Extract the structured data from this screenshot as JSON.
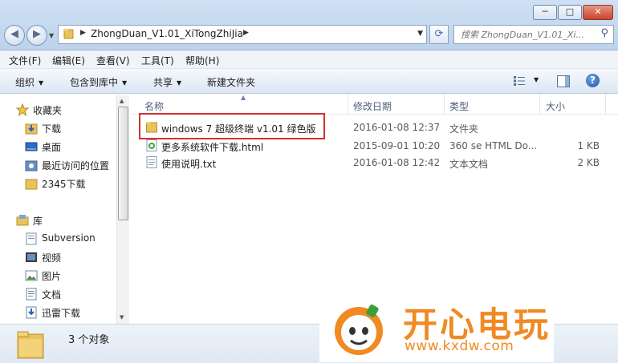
{
  "window": {
    "controls": {
      "minimize": "─",
      "maximize": "□",
      "close": "✕"
    }
  },
  "nav_buttons": {
    "back": "◀",
    "forward": "▶"
  },
  "address": {
    "path": "ZhongDuan_V1.01_XiTongZhiJia"
  },
  "search": {
    "placeholder": "搜索 ZhongDuan_V1.01_Xi..."
  },
  "menu": {
    "file": "文件(F)",
    "edit": "编辑(E)",
    "view": "查看(V)",
    "tools": "工具(T)",
    "help": "帮助(H)"
  },
  "toolbar": {
    "organize": "组织",
    "include_library": "包含到库中",
    "share": "共享",
    "new_folder": "新建文件夹",
    "help": "?"
  },
  "sidebar": {
    "favorites": "收藏夹",
    "downloads": "下载",
    "desktop": "桌面",
    "recent": "最近访问的位置",
    "dl2345": "2345下载",
    "libraries": "库",
    "subversion": "Subversion",
    "videos": "视频",
    "pictures": "图片",
    "documents": "文档",
    "thunder": "迅雷下载"
  },
  "columns": {
    "name": "名称",
    "modified": "修改日期",
    "type": "类型",
    "size": "大小"
  },
  "files": [
    {
      "name": "windows 7 超级终端 v1.01 绿色版",
      "modified": "2016-01-08 12:37",
      "type": "文件夹",
      "size": "",
      "icon": "folder-icon"
    },
    {
      "name": "更多系统软件下载.html",
      "modified": "2015-09-01 10:20",
      "type": "360 se HTML Do...",
      "size": "1 KB",
      "icon": "html-file-icon"
    },
    {
      "name": "使用说明.txt",
      "modified": "2016-01-08 12:42",
      "type": "文本文档",
      "size": "2 KB",
      "icon": "text-file-icon"
    }
  ],
  "status": {
    "count": "3 个对象"
  },
  "watermark": {
    "brand": "开心电玩",
    "url": "www.kxdw.com"
  },
  "colors": {
    "highlight_box": "#d3312c",
    "watermark": "#f08a23",
    "toolbar_bg": "#dbe6f3"
  }
}
